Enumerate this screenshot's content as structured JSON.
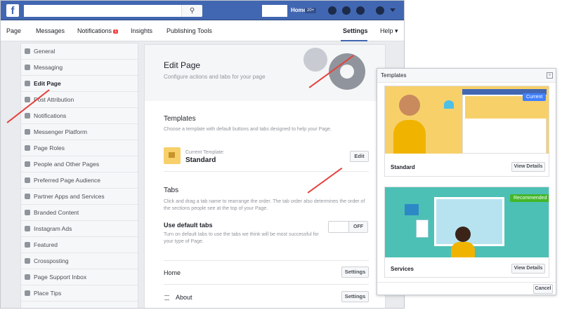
{
  "topbar": {
    "logo": "f",
    "home_label": "Home",
    "home_badge": "20+",
    "icons": [
      "friends-icon",
      "messenger-icon",
      "globe-icon",
      "help-icon"
    ]
  },
  "pagenav": {
    "items": [
      "Page",
      "Messages",
      "Notifications",
      "Insights",
      "Publishing Tools",
      "Settings",
      "Help ▾"
    ],
    "notifications_badge": "1",
    "active": "Settings"
  },
  "sidebar": {
    "items": [
      {
        "label": "General",
        "icon": "gear-icon"
      },
      {
        "label": "Messaging",
        "icon": "chat-icon"
      },
      {
        "label": "Edit Page",
        "icon": "pencil-icon",
        "active": true
      },
      {
        "label": "Post Attribution",
        "icon": "flag-icon"
      },
      {
        "label": "Notifications",
        "icon": "globe-icon"
      },
      {
        "label": "Messenger Platform",
        "icon": "messenger-icon"
      },
      {
        "label": "Page Roles",
        "icon": "person-icon"
      },
      {
        "label": "People and Other Pages",
        "icon": "people-icon"
      },
      {
        "label": "Preferred Page Audience",
        "icon": "audience-icon"
      },
      {
        "label": "Partner Apps and Services",
        "icon": "partner-icon"
      },
      {
        "label": "Branded Content",
        "icon": "handshake-icon"
      },
      {
        "label": "Instagram Ads",
        "icon": "instagram-icon"
      },
      {
        "label": "Featured",
        "icon": "star-icon"
      },
      {
        "label": "Crossposting",
        "icon": "video-icon"
      },
      {
        "label": "Page Support Inbox",
        "icon": "inbox-icon"
      },
      {
        "label": "Place Tips",
        "icon": "place-icon"
      }
    ]
  },
  "main": {
    "title": "Edit Page",
    "subtitle": "Configure actions and tabs for your page",
    "templates": {
      "heading": "Templates",
      "description": "Choose a template with default buttons and tabs designed to help your Page.",
      "current_label": "Current Template:",
      "current_value": "Standard",
      "edit_button": "Edit"
    },
    "tabs": {
      "heading": "Tabs",
      "description_1": "Click and drag a tab name to rearrange the order. The tab order also determines the order of",
      "description_2": "the sections people see at the top of your Page.",
      "default_label": "Use default tabs",
      "default_desc_1": "Turn on default tabs to use the tabs we think will be most successful for",
      "default_desc_2": "your type of Page.",
      "toggle": "OFF",
      "rows": [
        {
          "label": "Home",
          "button": "Settings"
        },
        {
          "label": "About",
          "button": "Settings"
        }
      ]
    }
  },
  "panel": {
    "title": "Templates",
    "cards": [
      {
        "label": "Standard",
        "button": "View Details",
        "badge": "Current",
        "badge_color": "#4080ff",
        "bg": "#f7d06a"
      },
      {
        "label": "Services",
        "button": "View Details",
        "badge": "Recommended",
        "badge_color": "#42b72a",
        "bg": "#4dc0b5"
      }
    ],
    "cancel_button": "Cancel"
  }
}
